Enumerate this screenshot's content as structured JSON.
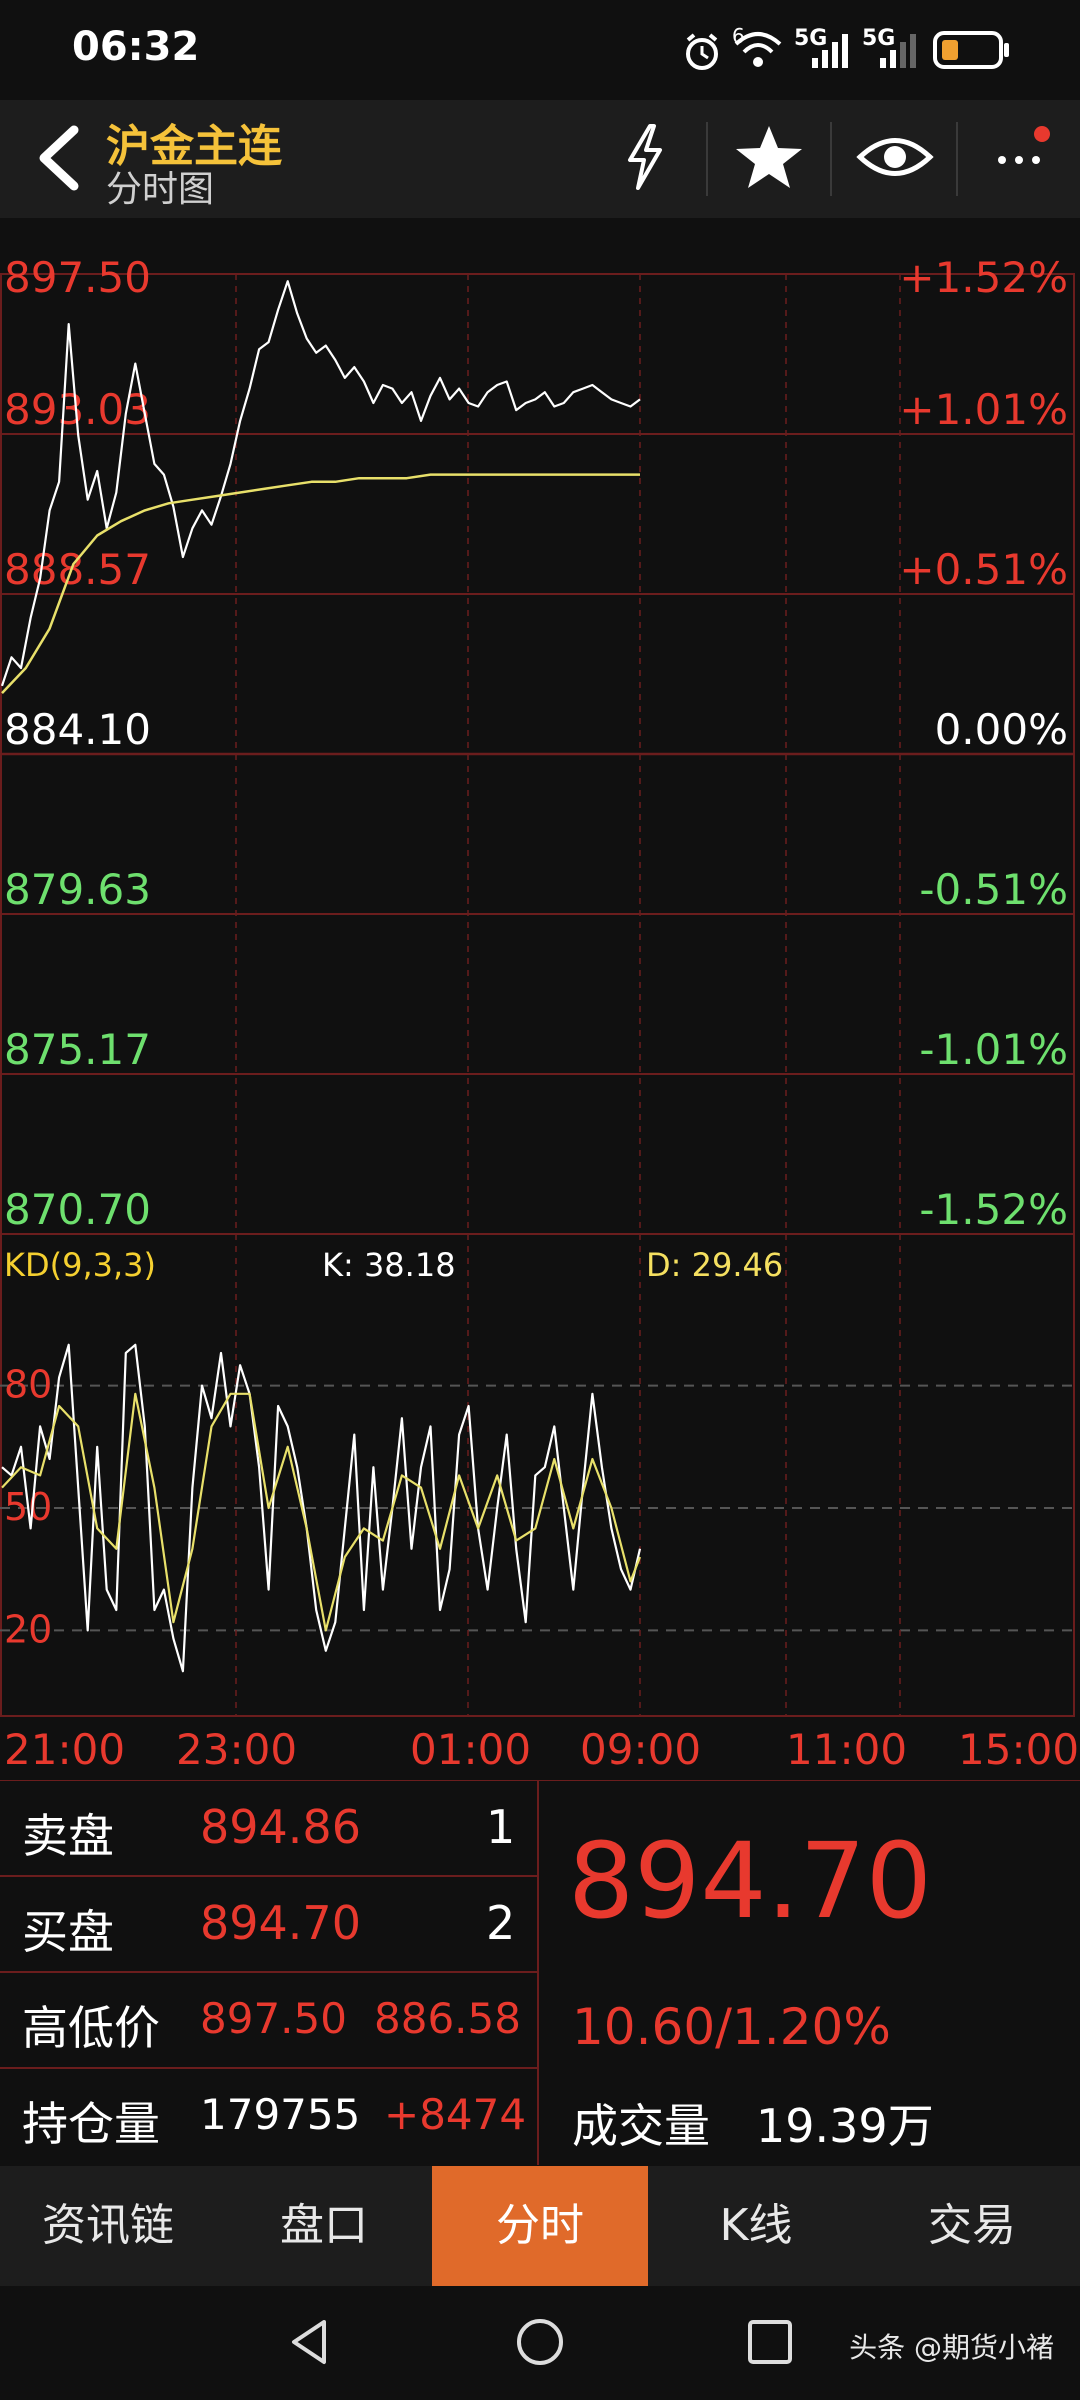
{
  "status_bar": {
    "time": "06:32",
    "icons": [
      "alarm-icon",
      "wifi-icon",
      "signal-5g-icon",
      "signal-5g-icon",
      "battery-icon"
    ],
    "wifi_badge": "6",
    "net1": "5G",
    "net2": "5G"
  },
  "header": {
    "title": "沪金主连",
    "subtitle": "分时图",
    "actions": [
      "lightning-icon",
      "star-icon",
      "eye-icon",
      "more-icon"
    ]
  },
  "price_axis": {
    "left_labels": [
      "897.50",
      "893.03",
      "888.57",
      "884.10",
      "879.63",
      "875.17",
      "870.70"
    ],
    "right_labels": [
      "+1.52%",
      "+1.01%",
      "+0.51%",
      "0.00%",
      "-0.51%",
      "-1.01%",
      "-1.52%"
    ]
  },
  "kd": {
    "label": "KD(9,3,3)",
    "k_label": "K: 38.18",
    "d_label": "D: 29.46",
    "levels": [
      "80",
      "50",
      "20"
    ]
  },
  "time_axis": [
    "21:00",
    "23:00",
    "01:00",
    "09:00",
    "11:00",
    "15:00"
  ],
  "chart_data": {
    "type": "line",
    "title": "分时图",
    "x_ticks": [
      "21:00",
      "23:00",
      "01:00",
      "09:00",
      "11:00",
      "15:00"
    ],
    "ylim": [
      870.7,
      897.5
    ],
    "base_price": 884.1,
    "series": [
      {
        "name": "price",
        "color": "#ffffff",
        "x": [
          0,
          4,
          8,
          12,
          16,
          20,
          24,
          28,
          32,
          36,
          40,
          44,
          48,
          52,
          56,
          60,
          64,
          68,
          72,
          76,
          80,
          84,
          88,
          92,
          96,
          100,
          104,
          108,
          112,
          116,
          120,
          124,
          128,
          132,
          136,
          140,
          144,
          148,
          152,
          156,
          160,
          164,
          168,
          172,
          176,
          180,
          184,
          188,
          192,
          196,
          200,
          204,
          208,
          212,
          216,
          220,
          224,
          228,
          232,
          236,
          240,
          244,
          248,
          252,
          256,
          260,
          264,
          268
        ],
        "values": [
          886.0,
          886.8,
          886.5,
          887.9,
          889.0,
          890.9,
          891.7,
          896.1,
          893.0,
          891.2,
          892.0,
          890.4,
          891.4,
          893.6,
          895.0,
          893.6,
          892.2,
          891.9,
          891.0,
          889.6,
          890.4,
          890.9,
          890.5,
          891.3,
          892.2,
          893.4,
          894.3,
          895.4,
          895.6,
          896.5,
          897.3,
          896.4,
          895.7,
          895.3,
          895.5,
          895.1,
          894.6,
          894.9,
          894.5,
          893.9,
          894.4,
          894.3,
          893.9,
          894.2,
          893.4,
          894.1,
          894.6,
          894.0,
          894.3,
          893.9,
          893.8,
          894.2,
          894.4,
          894.5,
          893.7,
          893.9,
          894.0,
          894.2,
          893.8,
          893.9,
          894.2,
          894.3,
          894.4,
          894.2,
          894.0,
          893.9,
          893.8,
          894.0
        ]
      },
      {
        "name": "average",
        "color": "#e8e06a",
        "x": [
          0,
          10,
          20,
          30,
          40,
          50,
          60,
          70,
          80,
          90,
          100,
          110,
          120,
          130,
          140,
          150,
          160,
          170,
          180,
          190,
          200,
          210,
          220,
          230,
          240,
          250,
          260,
          268
        ],
        "values": [
          885.8,
          886.5,
          887.6,
          889.4,
          890.2,
          890.6,
          890.9,
          891.1,
          891.2,
          891.3,
          891.4,
          891.5,
          891.6,
          891.7,
          891.7,
          891.8,
          891.8,
          891.8,
          891.9,
          891.9,
          891.9,
          891.9,
          891.9,
          891.9,
          891.9,
          891.9,
          891.9,
          891.9
        ]
      }
    ],
    "kd_series": [
      {
        "name": "K",
        "color": "#ffffff",
        "x": [
          0,
          4,
          8,
          12,
          16,
          20,
          24,
          28,
          32,
          36,
          40,
          44,
          48,
          52,
          56,
          60,
          64,
          68,
          72,
          76,
          80,
          84,
          88,
          92,
          96,
          100,
          104,
          108,
          112,
          116,
          120,
          124,
          128,
          132,
          136,
          140,
          144,
          148,
          152,
          156,
          160,
          164,
          168,
          172,
          176,
          180,
          184,
          188,
          192,
          196,
          200,
          204,
          208,
          212,
          216,
          220,
          224,
          228,
          232,
          236,
          240,
          244,
          248,
          252,
          256,
          260,
          264,
          268
        ],
        "values": [
          60,
          58,
          65,
          45,
          70,
          62,
          82,
          90,
          55,
          20,
          65,
          30,
          25,
          88,
          90,
          70,
          25,
          30,
          18,
          10,
          55,
          80,
          72,
          88,
          70,
          85,
          78,
          60,
          30,
          75,
          70,
          60,
          45,
          25,
          15,
          22,
          45,
          68,
          25,
          60,
          30,
          50,
          72,
          40,
          60,
          70,
          25,
          35,
          68,
          75,
          45,
          30,
          50,
          68,
          40,
          22,
          58,
          60,
          70,
          50,
          30,
          55,
          78,
          60,
          45,
          35,
          30,
          40
        ]
      },
      {
        "name": "D",
        "color": "#e8e06a",
        "x": [
          0,
          8,
          16,
          24,
          32,
          40,
          48,
          56,
          64,
          72,
          80,
          88,
          96,
          104,
          112,
          120,
          128,
          136,
          144,
          152,
          160,
          168,
          176,
          184,
          192,
          200,
          208,
          216,
          224,
          232,
          240,
          248,
          256,
          264,
          268
        ],
        "values": [
          55,
          60,
          58,
          75,
          70,
          45,
          40,
          78,
          55,
          22,
          40,
          70,
          78,
          78,
          50,
          65,
          45,
          20,
          38,
          45,
          42,
          58,
          55,
          40,
          58,
          45,
          58,
          42,
          45,
          62,
          45,
          62,
          50,
          32,
          38
        ]
      }
    ]
  },
  "order_panel": {
    "sell_label": "卖盘",
    "sell_price": "894.86",
    "sell_qty": "1",
    "buy_label": "买盘",
    "buy_price": "894.70",
    "buy_qty": "2",
    "hl_label": "高低价",
    "high": "897.50",
    "low": "886.58",
    "oi_label": "持仓量",
    "oi_value": "179755",
    "oi_change": "+8474",
    "last_price": "894.70",
    "change": "10.60/1.20%",
    "volume_label": "成交量",
    "volume_value": "19.39万"
  },
  "tabs": [
    "资讯链",
    "盘口",
    "分时",
    "K线",
    "交易"
  ],
  "active_tab": 2,
  "nav": [
    "back-icon",
    "home-icon",
    "recents-icon"
  ],
  "watermark": "头条 @期货小褚",
  "colors": {
    "up": "#e8392e",
    "down": "#6ee06e",
    "title": "#f5c23a",
    "active_tab": "#e06a2a",
    "grid": "#6b1d1d"
  }
}
